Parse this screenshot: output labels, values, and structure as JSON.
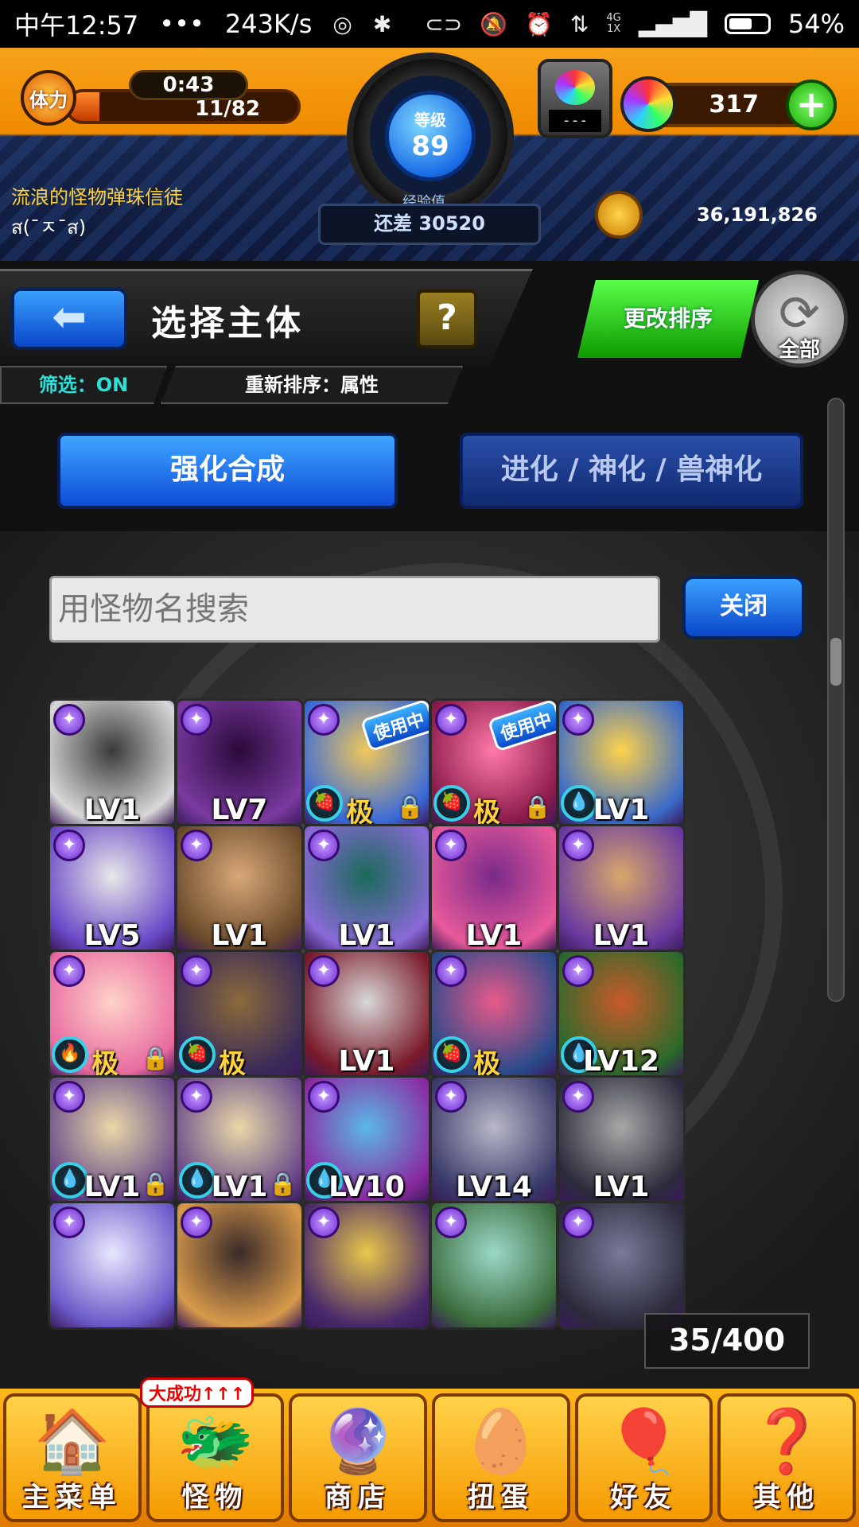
{
  "status_bar": {
    "time": "中午12:57",
    "dots": "•••",
    "speed": "243K/s",
    "net_top": "4G",
    "net_bottom": "1X",
    "battery": "54%"
  },
  "header": {
    "stamina_label": "体力",
    "stamina_timer": "0:43",
    "stamina_count": "11/82",
    "stamina_fraction": 0.134,
    "level_label": "等级",
    "level": "89",
    "exp_label": "经验值",
    "exp_remaining": "还差 30520",
    "machine_screen": "---",
    "orb_count": "317",
    "plus_label": "+",
    "player_name": "流浪的怪物弹珠信徒",
    "player_note": "ส(¯ㅈ¯ส)",
    "coins": "36,191,826"
  },
  "title_row": {
    "back_glyph": "⬅",
    "title": "选择主体",
    "help": "?",
    "filter": "筛选：ON",
    "sort_status": "重新排序：属性",
    "sort_button": "更改排序",
    "refresh_glyph": "⟳",
    "refresh_label": "全部"
  },
  "tabs": {
    "active": "强化合成",
    "inactive": "进化 / 神化 / 兽神化"
  },
  "search": {
    "placeholder": "用怪物名搜索",
    "close": "关闭"
  },
  "monster_grid": [
    {
      "level": "LV1",
      "c1": "#3a3a3a",
      "c2": "#d8d8d8"
    },
    {
      "level": "LV7",
      "c1": "#2a0a3a",
      "c2": "#7a3aa0"
    },
    {
      "level": "",
      "max": "极",
      "in_use": "使用中",
      "badge": "🍓",
      "lock": "🔒",
      "c1": "#f0c85a",
      "c2": "#3a6ad8"
    },
    {
      "level": "",
      "max": "极",
      "in_use": "使用中",
      "badge": "🍓",
      "lock": "🔒",
      "c1": "#ff7aa8",
      "c2": "#8a1a4a"
    },
    {
      "level": "LV1",
      "badge": "💧",
      "c1": "#ffd24a",
      "c2": "#3a6ac8"
    },
    {
      "level": "LV5",
      "c1": "#e8e8e8",
      "c2": "#6a4ac8"
    },
    {
      "level": "LV1",
      "c1": "#d8a878",
      "c2": "#6a4a2a"
    },
    {
      "level": "LV1",
      "c1": "#1a6a5a",
      "c2": "#8a6ad8"
    },
    {
      "level": "LV1",
      "c1": "#7a2a8a",
      "c2": "#e85a9a"
    },
    {
      "level": "LV1",
      "c1": "#d8a86a",
      "c2": "#6a3aa0"
    },
    {
      "level": "",
      "max": "极",
      "badge": "🔥",
      "lock": "🔒",
      "c1": "#ffd2c8",
      "c2": "#e86aa0"
    },
    {
      "level": "",
      "max": "极",
      "badge": "🍓",
      "c1": "#8a6a3a",
      "c2": "#3a2a5a"
    },
    {
      "level": "LV1",
      "c1": "#d8d8d8",
      "c2": "#7a1a2a"
    },
    {
      "level": "",
      "max": "极",
      "badge": "🍓",
      "c1": "#e85a8a",
      "c2": "#2a4a8a"
    },
    {
      "level": "LV12",
      "badge": "💧",
      "c1": "#c85a2a",
      "c2": "#2a6a2a"
    },
    {
      "level": "LV1",
      "badge": "💧",
      "lock": "🔒",
      "c1": "#e8d8a8",
      "c2": "#6a4a8a"
    },
    {
      "level": "LV1",
      "badge": "💧",
      "lock": "🔒",
      "c1": "#e8d8a8",
      "c2": "#6a4a8a"
    },
    {
      "level": "LV10",
      "badge": "💧",
      "c1": "#5ab8e8",
      "c2": "#8a2aa0"
    },
    {
      "level": "LV14",
      "c1": "#b8b8c8",
      "c2": "#3a3a6a"
    },
    {
      "level": "LV1",
      "c1": "#a8a8a8",
      "c2": "#2a2a3a"
    },
    {
      "level": "",
      "c1": "#e8e8ff",
      "c2": "#6a5ac8"
    },
    {
      "level": "",
      "c1": "#3a2a2a",
      "c2": "#d89a4a"
    },
    {
      "level": "",
      "c1": "#e8c84a",
      "c2": "#4a2a6a"
    },
    {
      "level": "",
      "c1": "#9ad8c8",
      "c2": "#3a6a3a"
    },
    {
      "level": "",
      "c1": "#7a7a9a",
      "c2": "#2a2a3a"
    }
  ],
  "box_count": "35/400",
  "bottom_nav": [
    {
      "label": "主菜单",
      "icon": "🏠"
    },
    {
      "label": "怪物",
      "icon": "🐲"
    },
    {
      "label": "商店",
      "icon": "🔮"
    },
    {
      "label": "扭蛋",
      "icon": "🥚"
    },
    {
      "label": "好友",
      "icon": "🎈"
    },
    {
      "label": "其他",
      "icon": "❓"
    }
  ],
  "nav_badge": "大成功↑↑↑"
}
